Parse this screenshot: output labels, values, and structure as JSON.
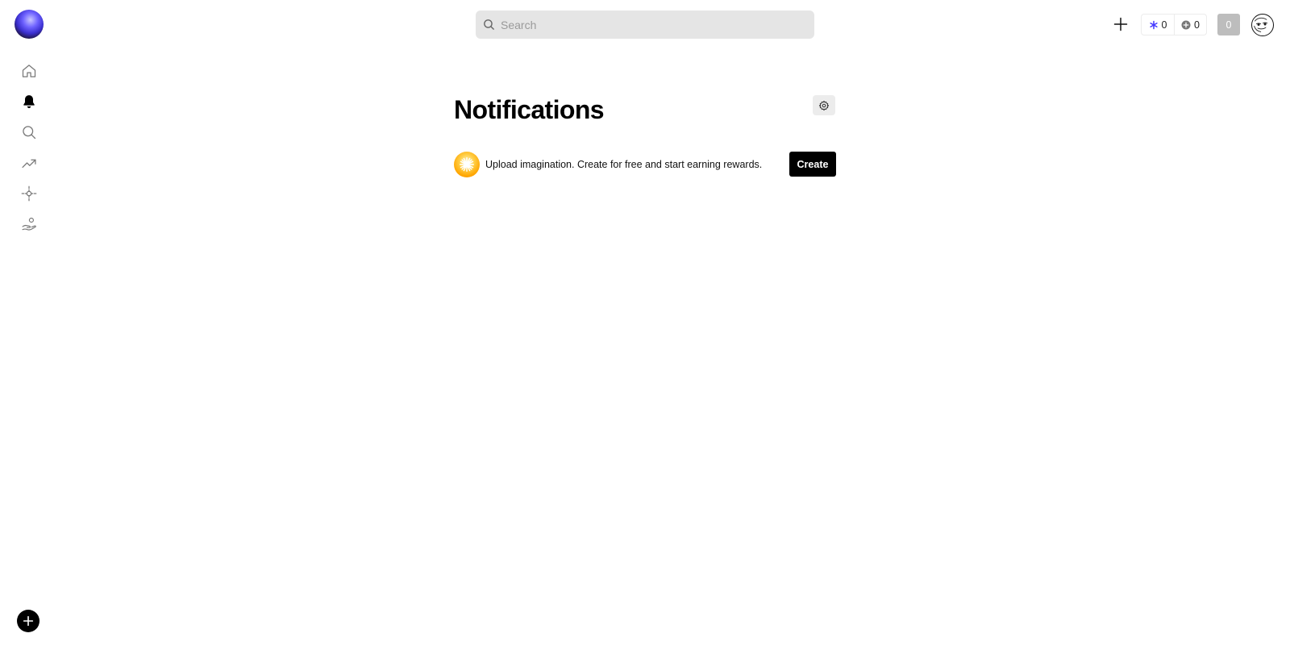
{
  "app": {
    "logo_icon": "gradient-orb-logo"
  },
  "sidebar": {
    "items": [
      {
        "name": "home",
        "icon": "home-icon",
        "active": false
      },
      {
        "name": "notifications",
        "icon": "bell-icon",
        "active": true
      },
      {
        "name": "search",
        "icon": "search-icon",
        "active": false
      },
      {
        "name": "trending",
        "icon": "trending-icon",
        "active": false
      },
      {
        "name": "explore",
        "icon": "crosshair-icon",
        "active": false
      },
      {
        "name": "rewards",
        "icon": "hand-coin-icon",
        "active": false
      }
    ],
    "fab_icon": "plus-icon"
  },
  "header": {
    "search": {
      "placeholder": "Search",
      "value": ""
    },
    "counters": [
      {
        "icon": "asterisk-icon",
        "value": "0",
        "color": "#4338ff"
      },
      {
        "icon": "plus-circle-icon",
        "value": "0",
        "color": "#777777"
      }
    ],
    "badge_value": "0"
  },
  "main": {
    "title": "Notifications",
    "promo": {
      "text": "Upload imagination. Create for free and start earning rewards.",
      "button_label": "Create"
    }
  },
  "colors": {
    "accent": "#4338ff",
    "button_bg": "#000000",
    "search_bg": "#e5e5e5",
    "badge_bg": "#bdbdbd"
  }
}
